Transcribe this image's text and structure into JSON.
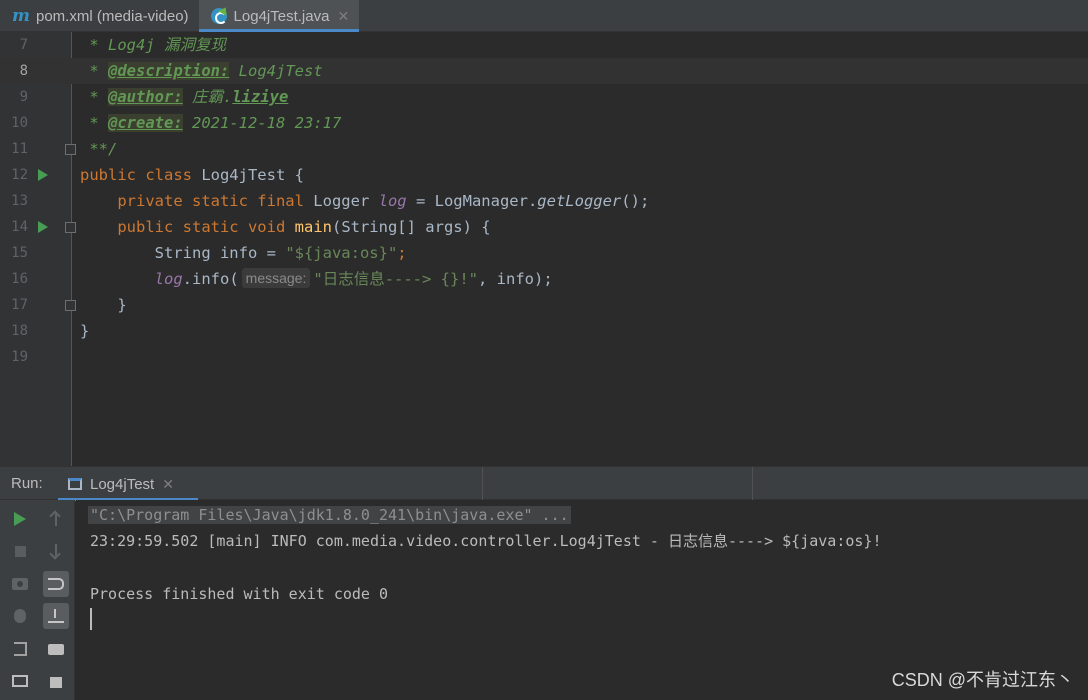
{
  "tabs": [
    {
      "label": "pom.xml (media-video)",
      "icon": "maven-icon",
      "active": false
    },
    {
      "label": "Log4jTest.java",
      "icon": "java-class-icon",
      "active": true
    }
  ],
  "editor": {
    "current_line": "8",
    "lines": [
      {
        "num": "7"
      },
      {
        "num": "8"
      },
      {
        "num": "9"
      },
      {
        "num": "10"
      },
      {
        "num": "11"
      },
      {
        "num": "12"
      },
      {
        "num": "13"
      },
      {
        "num": "14"
      },
      {
        "num": "15"
      },
      {
        "num": "16"
      },
      {
        "num": "17"
      },
      {
        "num": "18"
      },
      {
        "num": "19"
      }
    ],
    "code": {
      "l7_doc": " * Log4j 漏洞复现",
      "l8_star": " * ",
      "l8_tag": "@description:",
      "l8_val": " Log4jTest",
      "l9_star": " * ",
      "l9_tag": "@author:",
      "l9_val1": " 庄霸.",
      "l9_val2": "liziye",
      "l10_star": " * ",
      "l10_tag": "@create:",
      "l10_val": " 2021-12-18 23:17",
      "l11_doc": " **/",
      "l12_kw": "public class",
      "l12_rest": " Log4jTest {",
      "l13_indent": "    ",
      "l13_kw": "private static final",
      "l13_type": " Logger ",
      "l13_field": "log",
      "l13_eq": " = LogManager.",
      "l13_call": "getLogger",
      "l13_end": "();",
      "l14_indent": "    ",
      "l14_kw": "public static void",
      "l14_sp": " ",
      "l14_meth": "main",
      "l14_rest": "(String[] args) {",
      "l15_decl": "        String info = ",
      "l15_str": "\"${java:os}\"",
      "l15_semi": ";",
      "l16_indent": "        ",
      "l16_field": "log",
      "l16_call": ".info(",
      "l16_hint": "message:",
      "l16_str": "\"日志信息----> {}!\"",
      "l16_end": ", info);",
      "l17": "    }",
      "l18": "}"
    }
  },
  "run_panel": {
    "label": "Run:",
    "tab_label": "Log4jTest",
    "console": {
      "cmd": "\"C:\\Program Files\\Java\\jdk1.8.0_241\\bin\\java.exe\" ...",
      "log": "23:29:59.502 [main] INFO com.media.video.controller.Log4jTest - 日志信息----> ${java:os}!",
      "exit": "Process finished with exit code 0"
    }
  },
  "watermark": "CSDN @不肯过江东丶"
}
